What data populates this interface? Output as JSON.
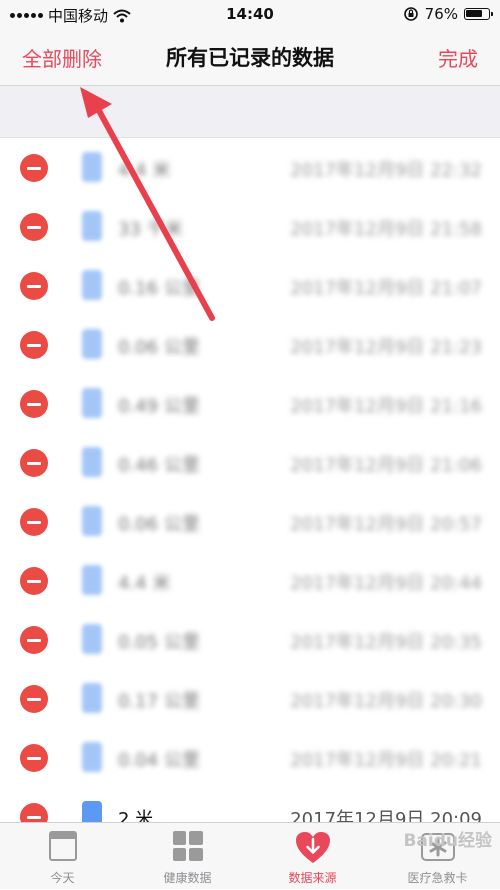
{
  "status_bar": {
    "carrier": "中国移动",
    "time": "14:40",
    "battery": "76%",
    "battery_level": 0.76
  },
  "nav": {
    "left_action": "全部删除",
    "title": "所有已记录的数据",
    "right_action": "完成"
  },
  "records": [
    {
      "value": "4.4 米",
      "date": "2017年12月9日 22:32"
    },
    {
      "value": "33 千米",
      "date": "2017年12月9日 21:58"
    },
    {
      "value": "0.16 公里",
      "date": "2017年12月9日 21:07"
    },
    {
      "value": "0.06 公里",
      "date": "2017年12月9日 21:23"
    },
    {
      "value": "0.49 公里",
      "date": "2017年12月9日 21:16"
    },
    {
      "value": "0.46 公里",
      "date": "2017年12月9日 21:06"
    },
    {
      "value": "0.06 公里",
      "date": "2017年12月9日 20:57"
    },
    {
      "value": "4.4 米",
      "date": "2017年12月9日 20:44"
    },
    {
      "value": "0.05 公里",
      "date": "2017年12月9日 20:35"
    },
    {
      "value": "0.17 公里",
      "date": "2017年12月9日 20:30"
    },
    {
      "value": "0.04 公里",
      "date": "2017年12月9日 20:21"
    },
    {
      "value": "2 米",
      "date": "2017年12月9日 20:09"
    }
  ],
  "tabs": [
    {
      "label": "今天",
      "icon": "calendar-icon"
    },
    {
      "label": "健康数据",
      "icon": "grid-icon"
    },
    {
      "label": "数据来源",
      "icon": "heart-icon"
    },
    {
      "label": "医疗急救卡",
      "icon": "medical-icon"
    }
  ],
  "active_tab": 2,
  "colors": {
    "accent": "#e8485a",
    "delete": "#ea4b45",
    "annotation_arrow": "#e8414d"
  },
  "watermark": "Baidu经验"
}
